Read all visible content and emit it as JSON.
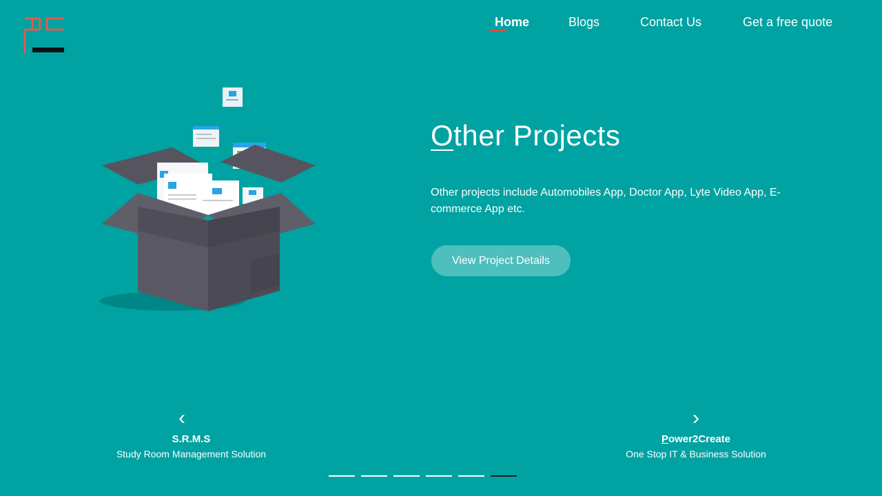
{
  "nav": {
    "items": [
      {
        "label": "Home",
        "active": true
      },
      {
        "label": "Blogs",
        "active": false
      },
      {
        "label": "Contact Us",
        "active": false
      },
      {
        "label": "Get a free quote",
        "active": false
      }
    ]
  },
  "hero": {
    "title_first": "O",
    "title_rest": "ther Projects",
    "description": " Other projects include Automobiles App, Doctor App, Lyte Video App, E-commerce App etc.",
    "cta_label": "View Project Details"
  },
  "carousel": {
    "prev": {
      "title": "S.R.M.S",
      "subtitle": "Study Room Management Solution"
    },
    "next": {
      "title_first": "P",
      "title_rest": "ower2Create",
      "subtitle": "One Stop IT & Business Solution"
    },
    "slide_count": 6,
    "active_index": 5
  },
  "icons": {
    "logo": "pc-logo",
    "prev": "chevron-left-icon",
    "next": "chevron-right-icon"
  },
  "colors": {
    "background": "#00a2a2",
    "accent": "#e74c3c",
    "button": "#4dbfbd"
  }
}
